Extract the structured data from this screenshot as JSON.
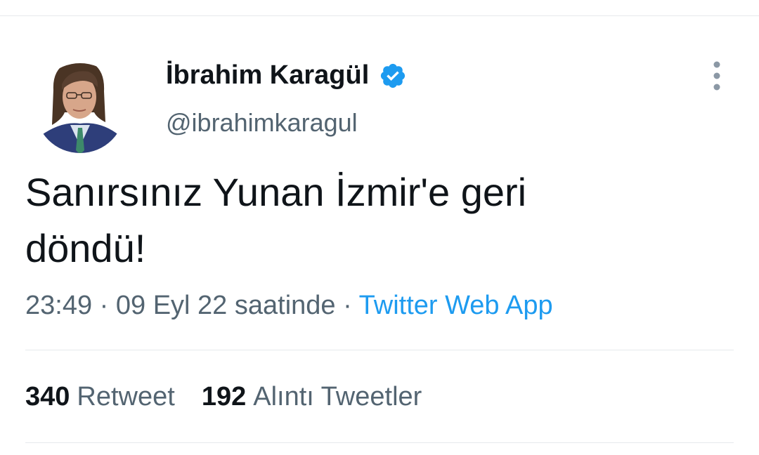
{
  "tweet": {
    "display_name": "İbrahim Karagül",
    "handle": "@ibrahimkaragul",
    "text_line1": "Sanırsınız Yunan İzmir'e geri",
    "text_line2": "döndü!",
    "time": "23:49",
    "date": "09 Eyl 22 saatinde",
    "separator": "·",
    "source": "Twitter Web App"
  },
  "stats": {
    "retweets_count": "340",
    "retweets_label": "Retweet",
    "quotes_count": "192",
    "quotes_label": "Alıntı Tweetler"
  },
  "colors": {
    "verified": "#1d9bf0",
    "link": "#1d9bf0",
    "secondary_text": "#536471",
    "primary_text": "#0f1419"
  },
  "icons": {
    "verified": "verified-badge-icon",
    "more": "more-vertical-icon"
  }
}
